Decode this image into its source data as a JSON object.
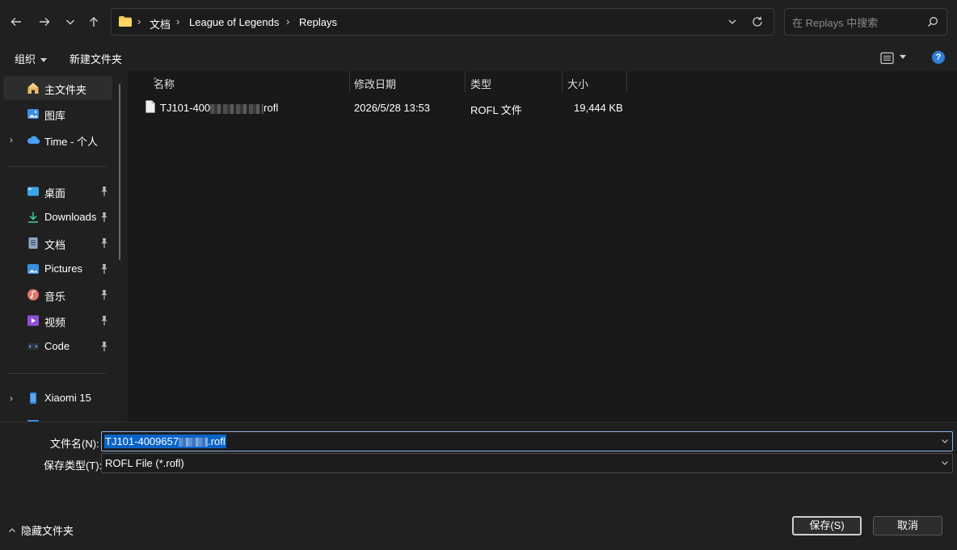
{
  "nav": {
    "back_icon": "arrow-left-icon",
    "forward_icon": "arrow-right-icon",
    "recent_icon": "chevron-down-icon",
    "up_icon": "arrow-up-icon"
  },
  "address": {
    "breadcrumbs": [
      "文档",
      "League of Legends",
      "Replays"
    ],
    "separator": "›",
    "folder_color": "#f2c94c"
  },
  "search": {
    "placeholder": "在 Replays 中搜索"
  },
  "commands": {
    "organize": "组织",
    "new_folder": "新建文件夹",
    "help": "?"
  },
  "sidebar": {
    "items": [
      {
        "label": "主文件夹",
        "icon": "home-icon",
        "selected": true
      },
      {
        "label": "图库",
        "icon": "gallery-icon"
      },
      {
        "label": "Time - 个人",
        "icon": "onedrive-icon",
        "expandable": true
      },
      {
        "label": "桌面",
        "icon": "desktop-icon",
        "pinned": true
      },
      {
        "label": "Downloads",
        "icon": "download-icon",
        "pinned": true
      },
      {
        "label": "文档",
        "icon": "document-icon",
        "pinned": true
      },
      {
        "label": "Pictures",
        "icon": "pictures-icon",
        "pinned": true
      },
      {
        "label": "音乐",
        "icon": "music-icon",
        "pinned": true
      },
      {
        "label": "视频",
        "icon": "video-icon",
        "pinned": true
      },
      {
        "label": "Code",
        "icon": "code-icon",
        "pinned": true
      },
      {
        "label": "Xiaomi 15",
        "icon": "phone-icon",
        "expandable": true
      }
    ]
  },
  "columns": [
    "名称",
    "修改日期",
    "类型",
    "大小"
  ],
  "files": [
    {
      "name_prefix": "TJ101-400",
      "name_suffix": "rofl",
      "modified": "2026/5/28 13:53",
      "type": "ROFL 文件",
      "size": "19,444 KB"
    }
  ],
  "save_form": {
    "filename_label": "文件名(N):",
    "filename_prefix": "TJ101-4009657",
    "filename_suffix": ".rofl",
    "type_label": "保存类型(T):",
    "type_value": "ROFL File (*.rofl)",
    "hide_folders": "隐藏文件夹",
    "save_button": "保存(S)",
    "cancel_button": "取消"
  }
}
